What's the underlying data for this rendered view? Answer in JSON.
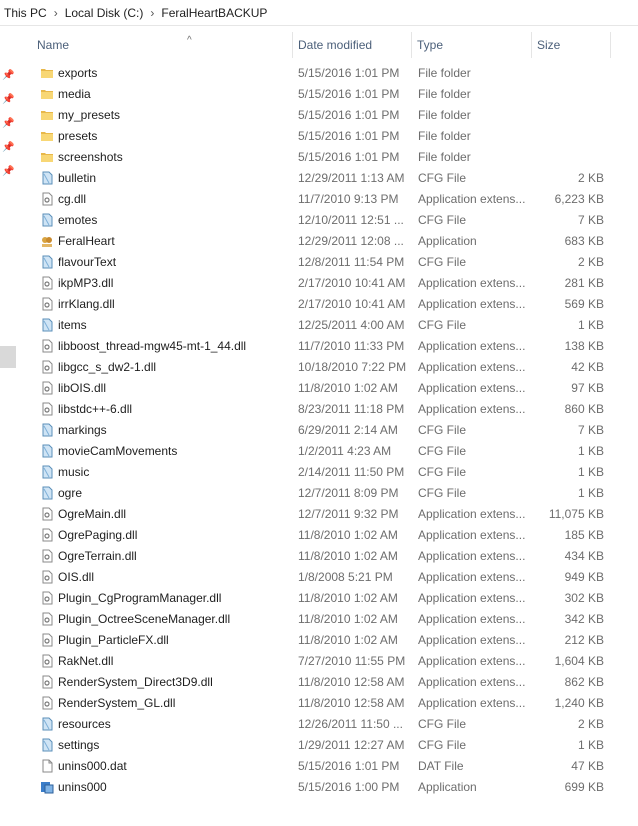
{
  "breadcrumb": [
    "This PC",
    "Local Disk (C:)",
    "FeralHeartBACKUP"
  ],
  "columns": {
    "name": "Name",
    "date": "Date modified",
    "type": "Type",
    "size": "Size"
  },
  "files": [
    {
      "name": "exports",
      "date": "5/15/2016 1:01 PM",
      "type": "File folder",
      "size": "",
      "icon": "folder-icon"
    },
    {
      "name": "media",
      "date": "5/15/2016 1:01 PM",
      "type": "File folder",
      "size": "",
      "icon": "folder-icon"
    },
    {
      "name": "my_presets",
      "date": "5/15/2016 1:01 PM",
      "type": "File folder",
      "size": "",
      "icon": "folder-icon"
    },
    {
      "name": "presets",
      "date": "5/15/2016 1:01 PM",
      "type": "File folder",
      "size": "",
      "icon": "folder-icon"
    },
    {
      "name": "screenshots",
      "date": "5/15/2016 1:01 PM",
      "type": "File folder",
      "size": "",
      "icon": "folder-icon"
    },
    {
      "name": "bulletin",
      "date": "12/29/2011 1:13 AM",
      "type": "CFG File",
      "size": "2 KB",
      "icon": "cfg-file-icon"
    },
    {
      "name": "cg.dll",
      "date": "11/7/2010 9:13 PM",
      "type": "Application extens...",
      "size": "6,223 KB",
      "icon": "dll-file-icon"
    },
    {
      "name": "emotes",
      "date": "12/10/2011 12:51 ...",
      "type": "CFG File",
      "size": "7 KB",
      "icon": "cfg-file-icon"
    },
    {
      "name": "FeralHeart",
      "date": "12/29/2011 12:08 ...",
      "type": "Application",
      "size": "683 KB",
      "icon": "app-icon"
    },
    {
      "name": "flavourText",
      "date": "12/8/2011 11:54 PM",
      "type": "CFG File",
      "size": "2 KB",
      "icon": "cfg-file-icon"
    },
    {
      "name": "ikpMP3.dll",
      "date": "2/17/2010 10:41 AM",
      "type": "Application extens...",
      "size": "281 KB",
      "icon": "dll-file-icon"
    },
    {
      "name": "irrKlang.dll",
      "date": "2/17/2010 10:41 AM",
      "type": "Application extens...",
      "size": "569 KB",
      "icon": "dll-file-icon"
    },
    {
      "name": "items",
      "date": "12/25/2011 4:00 AM",
      "type": "CFG File",
      "size": "1 KB",
      "icon": "cfg-file-icon"
    },
    {
      "name": "libboost_thread-mgw45-mt-1_44.dll",
      "date": "11/7/2010 11:33 PM",
      "type": "Application extens...",
      "size": "138 KB",
      "icon": "dll-file-icon"
    },
    {
      "name": "libgcc_s_dw2-1.dll",
      "date": "10/18/2010 7:22 PM",
      "type": "Application extens...",
      "size": "42 KB",
      "icon": "dll-file-icon"
    },
    {
      "name": "libOIS.dll",
      "date": "11/8/2010 1:02 AM",
      "type": "Application extens...",
      "size": "97 KB",
      "icon": "dll-file-icon"
    },
    {
      "name": "libstdc++-6.dll",
      "date": "8/23/2011 11:18 PM",
      "type": "Application extens...",
      "size": "860 KB",
      "icon": "dll-file-icon"
    },
    {
      "name": "markings",
      "date": "6/29/2011 2:14 AM",
      "type": "CFG File",
      "size": "7 KB",
      "icon": "cfg-file-icon"
    },
    {
      "name": "movieCamMovements",
      "date": "1/2/2011 4:23 AM",
      "type": "CFG File",
      "size": "1 KB",
      "icon": "cfg-file-icon"
    },
    {
      "name": "music",
      "date": "2/14/2011 11:50 PM",
      "type": "CFG File",
      "size": "1 KB",
      "icon": "cfg-file-icon"
    },
    {
      "name": "ogre",
      "date": "12/7/2011 8:09 PM",
      "type": "CFG File",
      "size": "1 KB",
      "icon": "cfg-file-icon"
    },
    {
      "name": "OgreMain.dll",
      "date": "12/7/2011 9:32 PM",
      "type": "Application extens...",
      "size": "11,075 KB",
      "icon": "dll-file-icon"
    },
    {
      "name": "OgrePaging.dll",
      "date": "11/8/2010 1:02 AM",
      "type": "Application extens...",
      "size": "185 KB",
      "icon": "dll-file-icon"
    },
    {
      "name": "OgreTerrain.dll",
      "date": "11/8/2010 1:02 AM",
      "type": "Application extens...",
      "size": "434 KB",
      "icon": "dll-file-icon"
    },
    {
      "name": "OIS.dll",
      "date": "1/8/2008 5:21 PM",
      "type": "Application extens...",
      "size": "949 KB",
      "icon": "dll-file-icon"
    },
    {
      "name": "Plugin_CgProgramManager.dll",
      "date": "11/8/2010 1:02 AM",
      "type": "Application extens...",
      "size": "302 KB",
      "icon": "dll-file-icon"
    },
    {
      "name": "Plugin_OctreeSceneManager.dll",
      "date": "11/8/2010 1:02 AM",
      "type": "Application extens...",
      "size": "342 KB",
      "icon": "dll-file-icon"
    },
    {
      "name": "Plugin_ParticleFX.dll",
      "date": "11/8/2010 1:02 AM",
      "type": "Application extens...",
      "size": "212 KB",
      "icon": "dll-file-icon"
    },
    {
      "name": "RakNet.dll",
      "date": "7/27/2010 11:55 PM",
      "type": "Application extens...",
      "size": "1,604 KB",
      "icon": "dll-file-icon"
    },
    {
      "name": "RenderSystem_Direct3D9.dll",
      "date": "11/8/2010 12:58 AM",
      "type": "Application extens...",
      "size": "862 KB",
      "icon": "dll-file-icon"
    },
    {
      "name": "RenderSystem_GL.dll",
      "date": "11/8/2010 12:58 AM",
      "type": "Application extens...",
      "size": "1,240 KB",
      "icon": "dll-file-icon"
    },
    {
      "name": "resources",
      "date": "12/26/2011 11:50 ...",
      "type": "CFG File",
      "size": "2 KB",
      "icon": "cfg-file-icon"
    },
    {
      "name": "settings",
      "date": "1/29/2011 12:27 AM",
      "type": "CFG File",
      "size": "1 KB",
      "icon": "cfg-file-icon"
    },
    {
      "name": "unins000.dat",
      "date": "5/15/2016 1:01 PM",
      "type": "DAT File",
      "size": "47 KB",
      "icon": "dat-file-icon"
    },
    {
      "name": "unins000",
      "date": "5/15/2016 1:00 PM",
      "type": "Application",
      "size": "699 KB",
      "icon": "uninstaller-icon"
    }
  ],
  "colors": {
    "folder": "#f8d775",
    "header_text": "#4c607a",
    "meta_text": "#6d6d6d"
  }
}
